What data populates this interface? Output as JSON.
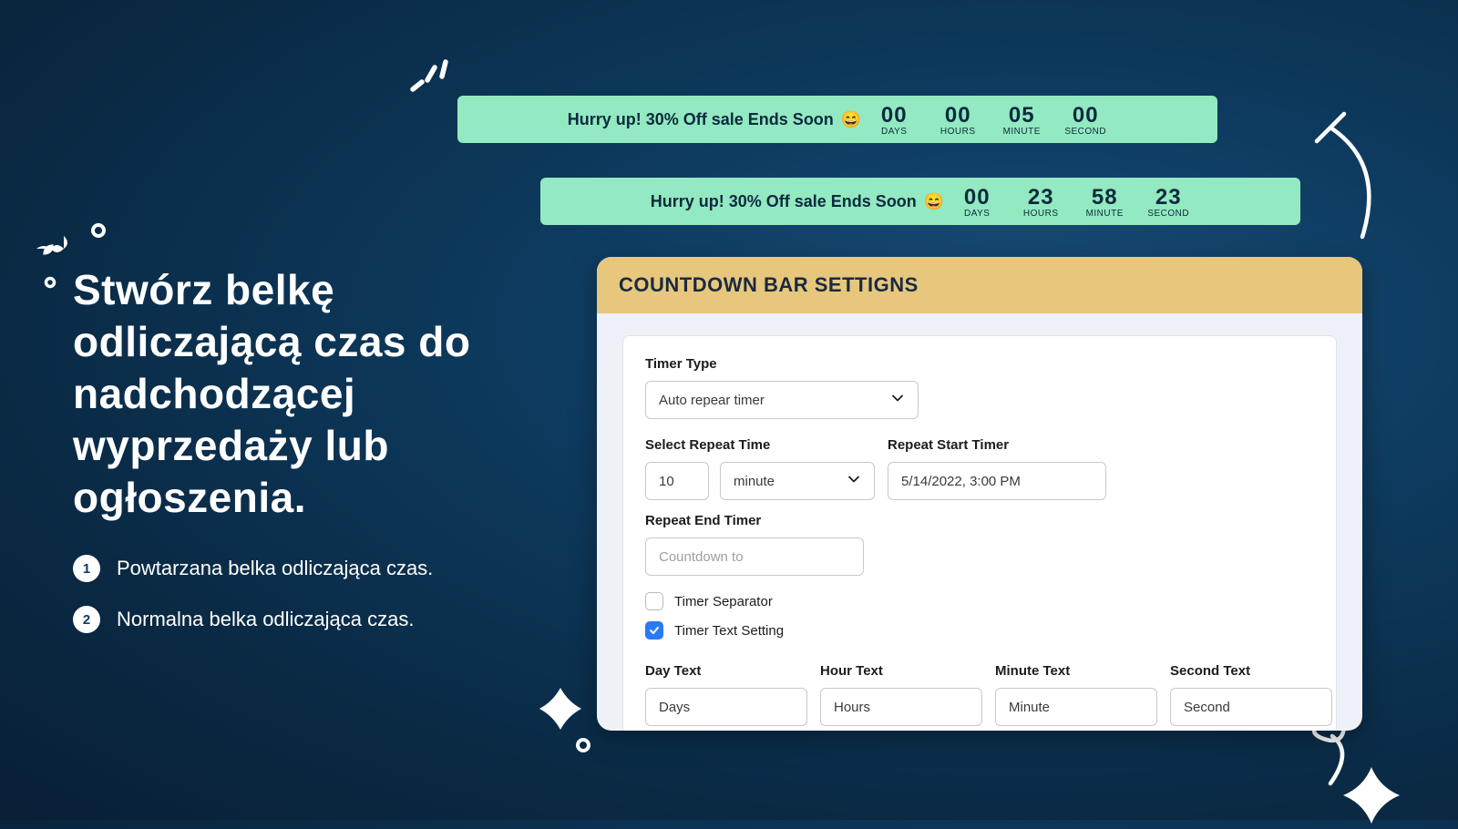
{
  "bar1": {
    "message": "Hurry up! 30% Off sale Ends Soon",
    "emoji": "😄",
    "timer": [
      {
        "value": "00",
        "label": "DAYS"
      },
      {
        "value": "00",
        "label": "HOURS"
      },
      {
        "value": "05",
        "label": "MINUTE"
      },
      {
        "value": "00",
        "label": "SECOND"
      }
    ]
  },
  "bar2": {
    "message": "Hurry up! 30% Off sale Ends Soon",
    "emoji": "😄",
    "timer": [
      {
        "value": "00",
        "label": "DAYS"
      },
      {
        "value": "23",
        "label": "HOURS"
      },
      {
        "value": "58",
        "label": "MINUTE"
      },
      {
        "value": "23",
        "label": "SECOND"
      }
    ]
  },
  "left": {
    "headline": "Stwórz belkę odliczającą czas do nadchodzącej wyprzedaży lub ogłoszenia.",
    "bullets": [
      "Powtarzana belka odliczająca czas.",
      "Normalna belka odliczająca czas."
    ]
  },
  "panel": {
    "title": "COUNTDOWN BAR SETTIGNS",
    "timer_type_label": "Timer Type",
    "timer_type_value": "Auto repear timer",
    "repeat_time_label": "Select Repeat Time",
    "repeat_time_value": "10",
    "repeat_time_unit": "minute",
    "repeat_start_label": "Repeat Start Timer",
    "repeat_start_value": "5/14/2022, 3:00 PM",
    "repeat_end_label": "Repeat End Timer",
    "repeat_end_placeholder": "Countdown to",
    "separator_label": "Timer Separator",
    "text_setting_label": "Timer Text Setting",
    "day_text_label": "Day Text",
    "day_text_value": "Days",
    "hour_text_label": "Hour Text",
    "hour_text_value": "Hours",
    "minute_text_label": "Minute Text",
    "minute_text_value": "Minute",
    "second_text_label": "Second Text",
    "second_text_value": "Second"
  }
}
